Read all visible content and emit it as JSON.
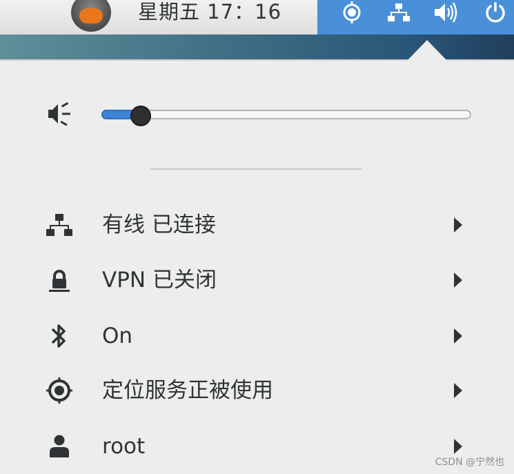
{
  "topbar": {
    "clock": "星期五 17：16",
    "app_icon": "activities-app-icon",
    "tray_icons": [
      "location-icon",
      "wired-network-icon",
      "volume-icon",
      "power-icon"
    ],
    "accent_color": "#4a90d9"
  },
  "volume": {
    "icon": "volume-low-icon",
    "level": 0.07,
    "accent_color": "#3d84d6"
  },
  "menu": {
    "items": [
      {
        "icon": "wired-network-icon",
        "label": "有线 已连接"
      },
      {
        "icon": "vpn-lock-icon",
        "label": "VPN 已关闭"
      },
      {
        "icon": "bluetooth-icon",
        "label": "On"
      },
      {
        "icon": "location-icon",
        "label": "定位服务正被使用"
      },
      {
        "icon": "user-icon",
        "label": "root"
      }
    ]
  },
  "watermark": "CSDN @宁然也"
}
